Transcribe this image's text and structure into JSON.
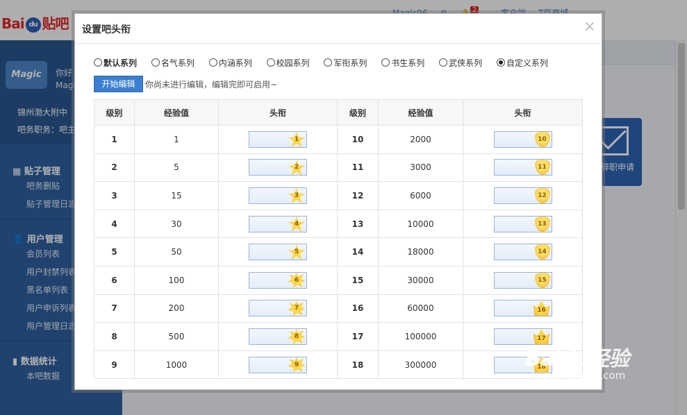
{
  "page": {
    "logo": {
      "red": "Bai",
      "paw": "du",
      "blue": "贴吧"
    },
    "top_links": {
      "user": "Magic96",
      "badge": "2",
      "client": "客户端",
      "mall": "T豆商城"
    },
    "sidebar": {
      "avatar_text": "Magic",
      "greeting": "你好",
      "greeting_name": "Magi",
      "school": "锦州渤大附中",
      "role": "吧务职务：吧主",
      "sections": [
        {
          "title": "贴子管理",
          "items": [
            "吧务删贴",
            "贴子管理日志"
          ]
        },
        {
          "title": "用户管理",
          "items": [
            "会员列表",
            "用户封禁列表",
            "黑名单列表",
            "用户申诉列表",
            "用户管理日志"
          ]
        },
        {
          "title": "数据统计",
          "items": [
            "本吧数据"
          ]
        }
      ]
    },
    "mail_card_label": "辞职申请"
  },
  "dialog": {
    "title": "设置吧头衔",
    "close": "×",
    "series": [
      {
        "label": "默认系列",
        "checked": false
      },
      {
        "label": "名气系列",
        "checked": false
      },
      {
        "label": "内涵系列",
        "checked": false
      },
      {
        "label": "校园系列",
        "checked": false
      },
      {
        "label": "军衔系列",
        "checked": false
      },
      {
        "label": "书生系列",
        "checked": false
      },
      {
        "label": "武侠系列",
        "checked": false
      },
      {
        "label": "自定义系列",
        "checked": true
      }
    ],
    "edit_button": "开始编辑",
    "edit_hint": "你尚未进行编辑，编辑完即可启用~",
    "table": {
      "headers": [
        "级别",
        "经验值",
        "头衔",
        "级别",
        "经验值",
        "头衔"
      ],
      "rows": [
        {
          "l1": "1",
          "e1": "1",
          "l2": "10",
          "e2": "2000"
        },
        {
          "l1": "2",
          "e1": "5",
          "l2": "11",
          "e2": "3000"
        },
        {
          "l1": "3",
          "e1": "15",
          "l2": "12",
          "e2": "6000"
        },
        {
          "l1": "4",
          "e1": "30",
          "l2": "13",
          "e2": "10000"
        },
        {
          "l1": "5",
          "e1": "50",
          "l2": "14",
          "e2": "18000"
        },
        {
          "l1": "6",
          "e1": "100",
          "l2": "15",
          "e2": "30000"
        },
        {
          "l1": "7",
          "e1": "200",
          "l2": "16",
          "e2": "60000"
        },
        {
          "l1": "8",
          "e1": "500",
          "l2": "17",
          "e2": "100000"
        },
        {
          "l1": "9",
          "e1": "1000",
          "l2": "18",
          "e2": "300000"
        }
      ]
    }
  },
  "watermark": {
    "line1": "Baidu经验",
    "line2": "jingyan.baidu.com"
  },
  "colors": {
    "accent": "#3a7fcf",
    "sidebar": "#2f5f9e",
    "badge_gold": "#f0a515"
  }
}
